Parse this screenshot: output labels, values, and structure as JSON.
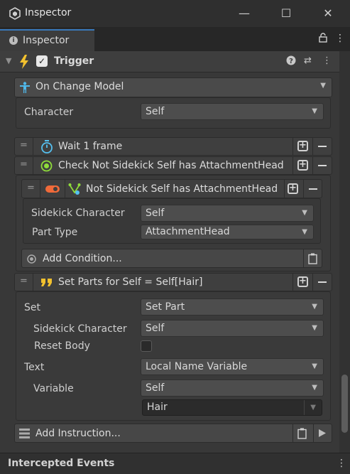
{
  "window": {
    "title": "Inspector",
    "minimize": "—",
    "maximize": "☐",
    "close": "✕"
  },
  "tab": {
    "label": "Inspector",
    "info": "i"
  },
  "tabbar_icons": {
    "lock": "🔓",
    "menu": "⋮"
  },
  "component": {
    "name": "Trigger",
    "enabled": true,
    "icons": {
      "help": "?",
      "settings": "⇄",
      "menu": "⋮"
    }
  },
  "event": {
    "label": "On Change Model",
    "character_label": "Character",
    "character_value": "Self"
  },
  "instructions": [
    {
      "label": "Wait 1 frame"
    },
    {
      "label": "Check Not Sidekick Self has AttachmentHead"
    }
  ],
  "condition": {
    "label": "Not Sidekick Self has AttachmentHead",
    "sidekick_label": "Sidekick Character",
    "sidekick_value": "Self",
    "part_type_label": "Part Type",
    "part_type_value": "AttachmentHead",
    "add_label": "Add Condition..."
  },
  "set_parts": {
    "label": "Set Parts for Self = Self[Hair]",
    "set_label": "Set",
    "set_value": "Set Part",
    "sidekick_label": "Sidekick Character",
    "sidekick_value": "Self",
    "reset_body_label": "Reset Body",
    "text_label": "Text",
    "text_value": "Local Name Variable",
    "variable_label": "Variable",
    "variable_value": "Self",
    "variable_name": "Hair"
  },
  "add_instruction": {
    "label": "Add Instruction..."
  },
  "footer": {
    "title": "Intercepted Events",
    "menu": "⋮"
  },
  "colors": {
    "accent": "#3a79bb",
    "bolt": "#f2c12e",
    "timer": "#55c0f0",
    "check": "#8fdc3a",
    "quote": "#f2c12e",
    "toggle": "#f06a3a"
  }
}
